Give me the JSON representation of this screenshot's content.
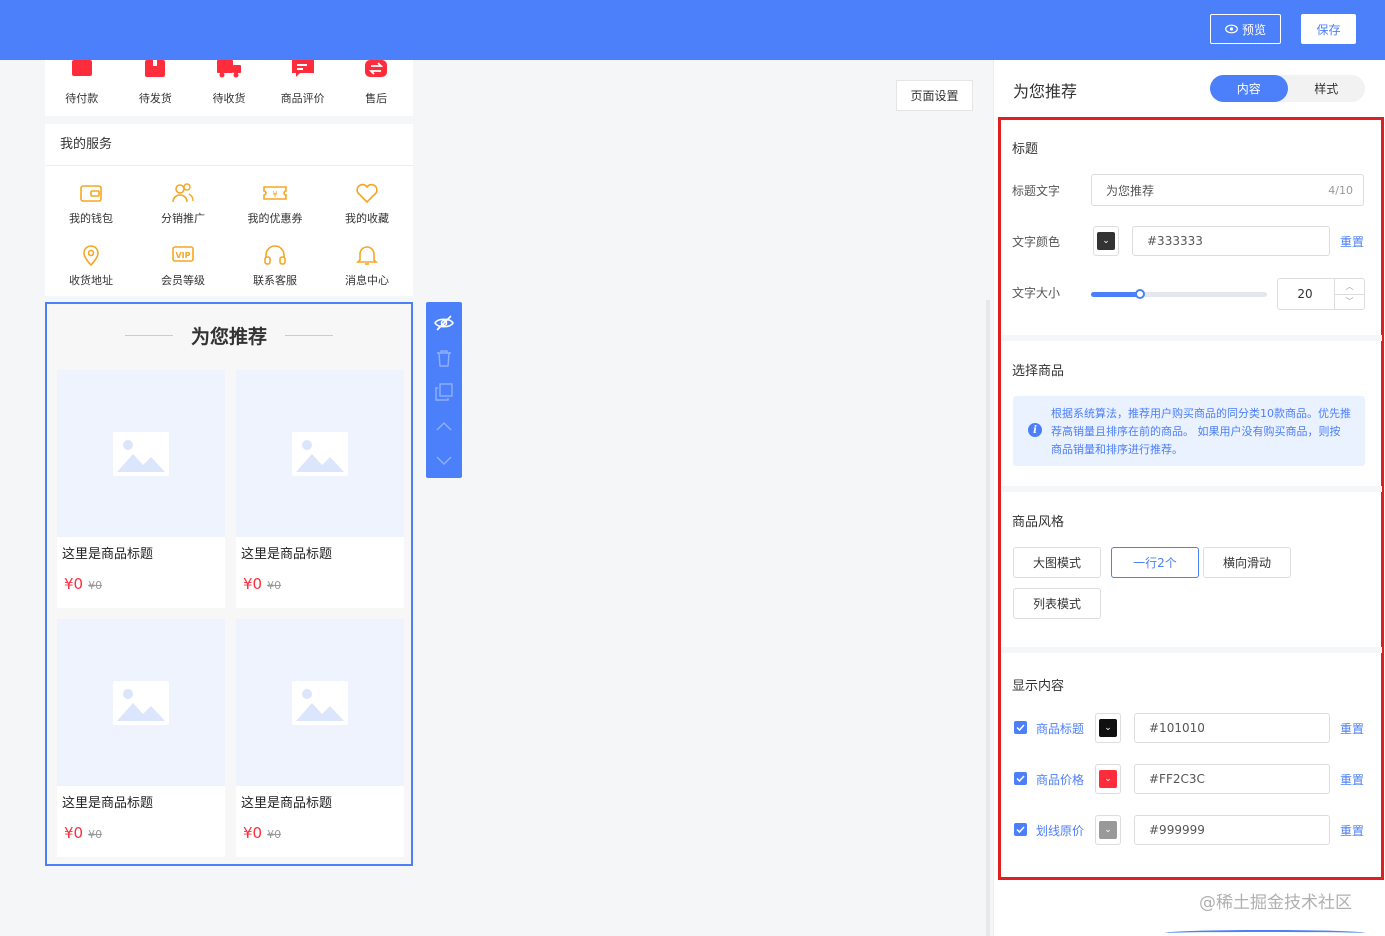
{
  "toolbar": {
    "preview_label": "预览",
    "save_label": "保存"
  },
  "orders": [
    {
      "label": "待付款",
      "icon": "wallet-red-icon"
    },
    {
      "label": "待发货",
      "icon": "package-red-icon"
    },
    {
      "label": "待收货",
      "icon": "truck-red-icon"
    },
    {
      "label": "商品评价",
      "icon": "comment-red-icon"
    },
    {
      "label": "售后",
      "icon": "refund-red-icon"
    }
  ],
  "services": {
    "title": "我的服务",
    "items": [
      {
        "label": "我的钱包",
        "icon": "wallet-icon"
      },
      {
        "label": "分销推广",
        "icon": "users-icon"
      },
      {
        "label": "我的优惠券",
        "icon": "coupon-icon"
      },
      {
        "label": "我的收藏",
        "icon": "heart-icon"
      },
      {
        "label": "收货地址",
        "icon": "location-icon"
      },
      {
        "label": "会员等级",
        "icon": "vip-icon"
      },
      {
        "label": "联系客服",
        "icon": "headset-icon"
      },
      {
        "label": "消息中心",
        "icon": "bell-icon"
      }
    ]
  },
  "recommend": {
    "title": "为您推荐",
    "goods": [
      {
        "name": "这里是商品标题",
        "price": "¥0",
        "original_price": "¥0"
      },
      {
        "name": "这里是商品标题",
        "price": "¥0",
        "original_price": "¥0"
      },
      {
        "name": "这里是商品标题",
        "price": "¥0",
        "original_price": "¥0"
      },
      {
        "name": "这里是商品标题",
        "price": "¥0",
        "original_price": "¥0"
      }
    ]
  },
  "page_setting_label": "页面设置",
  "panel": {
    "title": "为您推荐",
    "tabs": [
      {
        "label": "内容",
        "active": true
      },
      {
        "label": "样式",
        "active": false
      }
    ],
    "title_section": {
      "heading": "标题",
      "title_text_label": "标题文字",
      "title_text_value": "为您推荐",
      "title_text_count": "4/10",
      "color_label": "文字颜色",
      "color_value": "#333333",
      "color_reset": "重置",
      "size_label": "文字大小",
      "size_value": "20",
      "size_fraction": 0.2
    },
    "goods_section": {
      "heading": "选择商品",
      "notice": "根据系统算法，推荐用户购买商品的同分类10款商品。优先推荐高销量且排序在前的商品。 如果用户没有购买商品，则按商品销量和排序进行推荐。"
    },
    "style_section": {
      "heading": "商品风格",
      "options": [
        {
          "label": "大图模式",
          "active": false
        },
        {
          "label": "一行2个",
          "active": true
        },
        {
          "label": "横向滑动",
          "active": false
        },
        {
          "label": "列表模式",
          "active": false
        }
      ]
    },
    "display_section": {
      "heading": "显示内容",
      "rows": [
        {
          "label": "商品标题",
          "color": "#101010",
          "reset": "重置",
          "checked": true
        },
        {
          "label": "商品价格",
          "color": "#FF2C3C",
          "reset": "重置",
          "checked": true
        },
        {
          "label": "划线原价",
          "color": "#999999",
          "reset": "重置",
          "checked": true
        }
      ]
    }
  },
  "watermark": "@稀土掘金技术社区",
  "colors": {
    "accent": "#4c7ffa",
    "price": "#ff2c3c",
    "highlight_border": "#e02020"
  }
}
